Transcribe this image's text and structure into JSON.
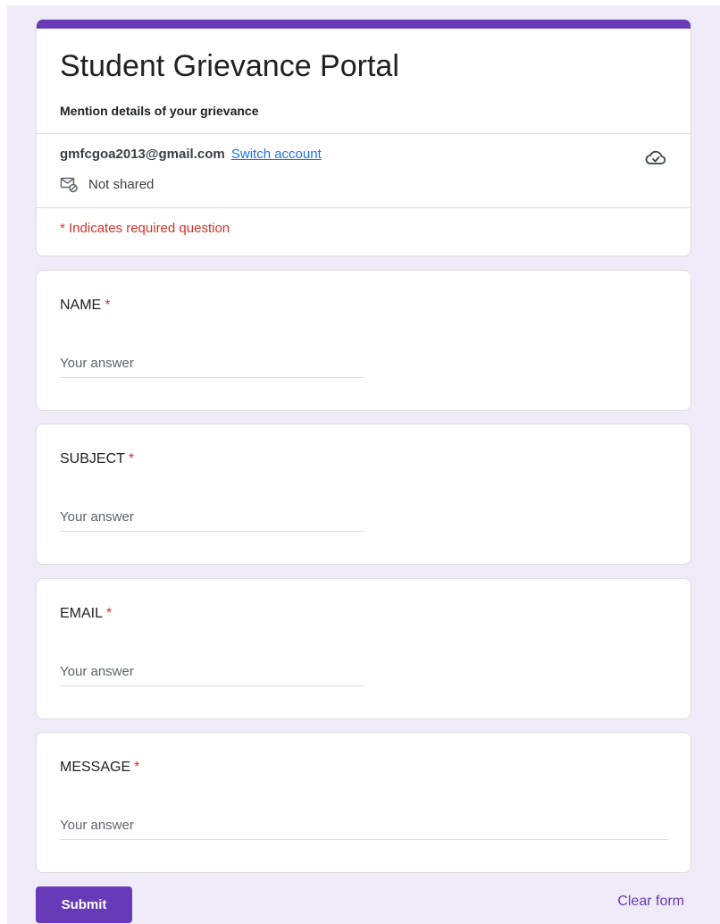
{
  "form": {
    "title": "Student Grievance Portal",
    "description": "Mention details of your grievance",
    "accent_color": "#673ab7"
  },
  "account": {
    "email": "gmfcgoa2013@gmail.com",
    "switch_label": "Switch account",
    "shared_status": "Not shared",
    "shared_icon": "mail-not-shared-icon",
    "cloud_icon": "cloud-saved-icon"
  },
  "required_note": "* Indicates required question",
  "questions": [
    {
      "label": "NAME",
      "required_mark": "*",
      "placeholder": "Your answer",
      "value": ""
    },
    {
      "label": "SUBJECT",
      "required_mark": "*",
      "placeholder": "Your answer",
      "value": ""
    },
    {
      "label": "EMAIL",
      "required_mark": "*",
      "placeholder": "Your answer",
      "value": ""
    },
    {
      "label": "MESSAGE",
      "required_mark": "*",
      "placeholder": "Your answer",
      "value": ""
    }
  ],
  "actions": {
    "submit_label": "Submit",
    "clear_label": "Clear form"
  }
}
